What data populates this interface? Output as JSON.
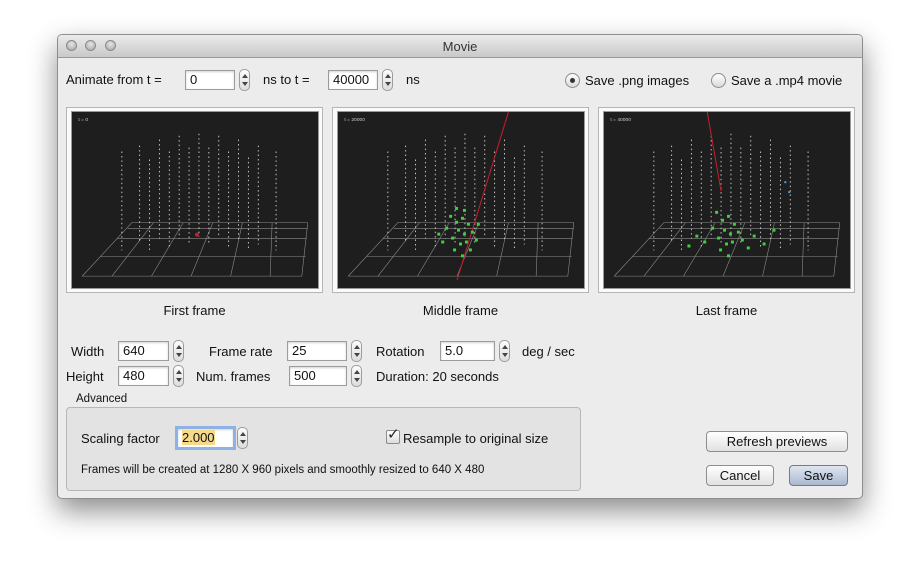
{
  "window": {
    "title": "Movie"
  },
  "animate": {
    "from_label": "Animate from t =",
    "from_value": "0",
    "to_label": "ns to t =",
    "to_value": "40000",
    "unit": "ns"
  },
  "output": {
    "png_label": "Save .png images",
    "png_selected": true,
    "mp4_label": "Save a .mp4 movie",
    "mp4_selected": false
  },
  "previews": [
    {
      "caption": "First frame",
      "time_text": "t = 0"
    },
    {
      "caption": "Middle frame",
      "time_text": "t = 20000"
    },
    {
      "caption": "Last frame",
      "time_text": "t = 40000"
    }
  ],
  "settings": {
    "width_label": "Width",
    "width_value": "640",
    "height_label": "Height",
    "height_value": "480",
    "frame_rate_label": "Frame rate",
    "frame_rate_value": "25",
    "num_frames_label": "Num. frames",
    "num_frames_value": "500",
    "rotation_label": "Rotation",
    "rotation_value": "5.0",
    "rotation_unit": "deg / sec",
    "duration_text": "Duration: 20 seconds"
  },
  "advanced": {
    "title": "Advanced",
    "scaling_label": "Scaling factor",
    "scaling_value": "2.000",
    "resample_label": "Resample to original size",
    "resample_checked": true,
    "note": "Frames will be created at 1280 X 960 pixels and smoothly resized to 640 X 480"
  },
  "buttons": {
    "refresh": "Refresh previews",
    "cancel": "Cancel",
    "save": "Save"
  },
  "colors": {
    "preview_background": "#1e1e1e",
    "hit_green": "#3cd23c",
    "track_red": "#c81e2d",
    "scaling_highlight": "#f7d98a",
    "default_button": "#a9b8cf"
  }
}
